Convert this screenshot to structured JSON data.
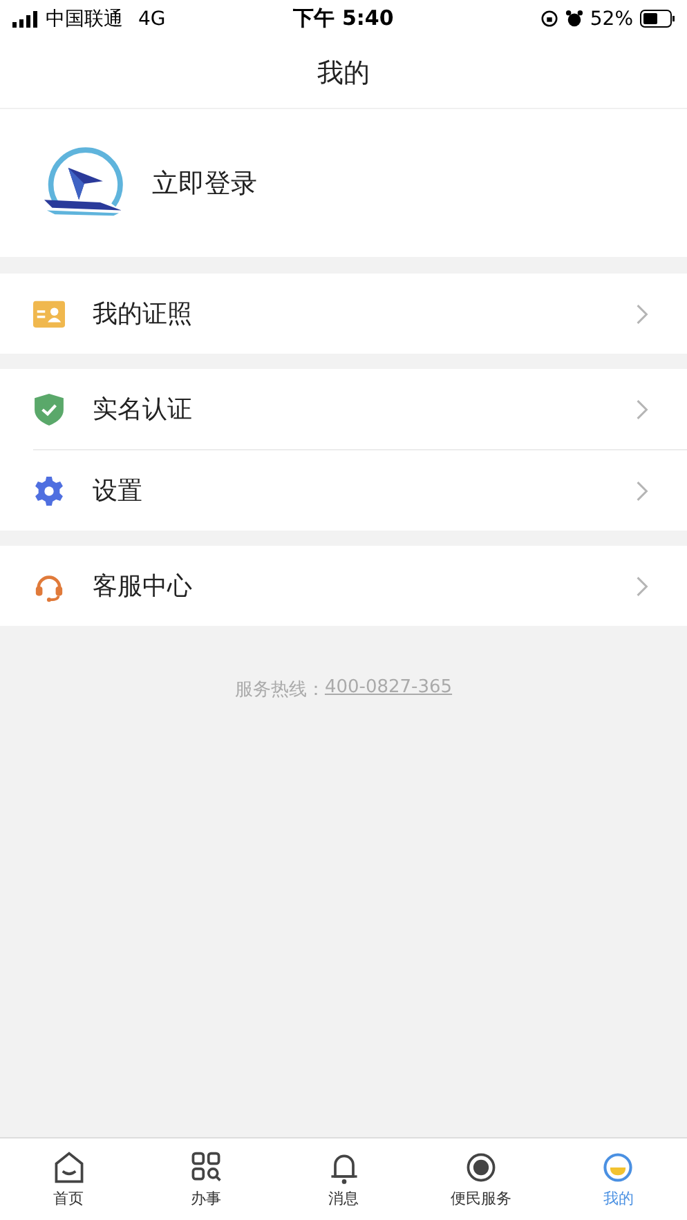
{
  "status_bar": {
    "carrier": "中国联通",
    "network": "4G",
    "time": "下午 5:40",
    "battery": "52%"
  },
  "header": {
    "title": "我的"
  },
  "profile": {
    "login_label": "立即登录"
  },
  "menu_groups": [
    {
      "items": [
        {
          "kind": "license",
          "label": "我的证照"
        }
      ]
    },
    {
      "items": [
        {
          "kind": "verify",
          "label": "实名认证"
        },
        {
          "kind": "settings",
          "label": "设置"
        }
      ]
    },
    {
      "items": [
        {
          "kind": "support",
          "label": "客服中心"
        }
      ]
    }
  ],
  "hotline": {
    "label": "服务热线：",
    "number": "400-0827-365"
  },
  "tab_bar": [
    {
      "kind": "home",
      "label": "首页",
      "selected": false
    },
    {
      "kind": "apps",
      "label": "办事",
      "selected": false
    },
    {
      "kind": "bell",
      "label": "消息",
      "selected": false
    },
    {
      "kind": "service",
      "label": "便民服务",
      "selected": false
    },
    {
      "kind": "me",
      "label": "我的",
      "selected": true
    }
  ]
}
